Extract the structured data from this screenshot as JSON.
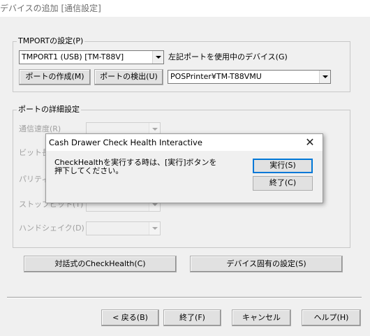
{
  "window": {
    "title": "デバイスの追加 [通信設定]"
  },
  "tmport_group": {
    "legend": "TMPORTの設定(P)",
    "port_combo_value": "TMPORT1 (USB) [TM-T88V]",
    "device_label": "左記ポートを使用中のデバイス(G)",
    "create_port_button": "ポートの作成(M)",
    "detect_port_button": "ポートの検出(U)",
    "device_combo_value": "POSPrinter¥TM-T88VMU"
  },
  "details_group": {
    "legend": "ポートの詳細設定",
    "baud_label": "通信速度(R)",
    "bits_label": "ビット長(",
    "parity_label": "パリティ(",
    "stopbits_label": "ストップビット(T)",
    "handshake_label": "ハンドシェイク(D)"
  },
  "action_buttons": {
    "interactive_checkhealth": "対話式のCheckHealth(C)",
    "device_specific_settings": "デバイス固有の設定(S)"
  },
  "footer": {
    "back": "< 戻る(B)",
    "finish": "終了(F)",
    "cancel": "キャンセル",
    "help": "ヘルプ(H)"
  },
  "dialog": {
    "title": "Cash Drawer   Check Health Interactive",
    "message_line1": "CheckHealthを実行する時は、[実行]ボタンを",
    "message_line2": "押下してください。",
    "execute_button": "実行(S)",
    "close_button": "終了(C)",
    "close_glyph": "✕"
  }
}
